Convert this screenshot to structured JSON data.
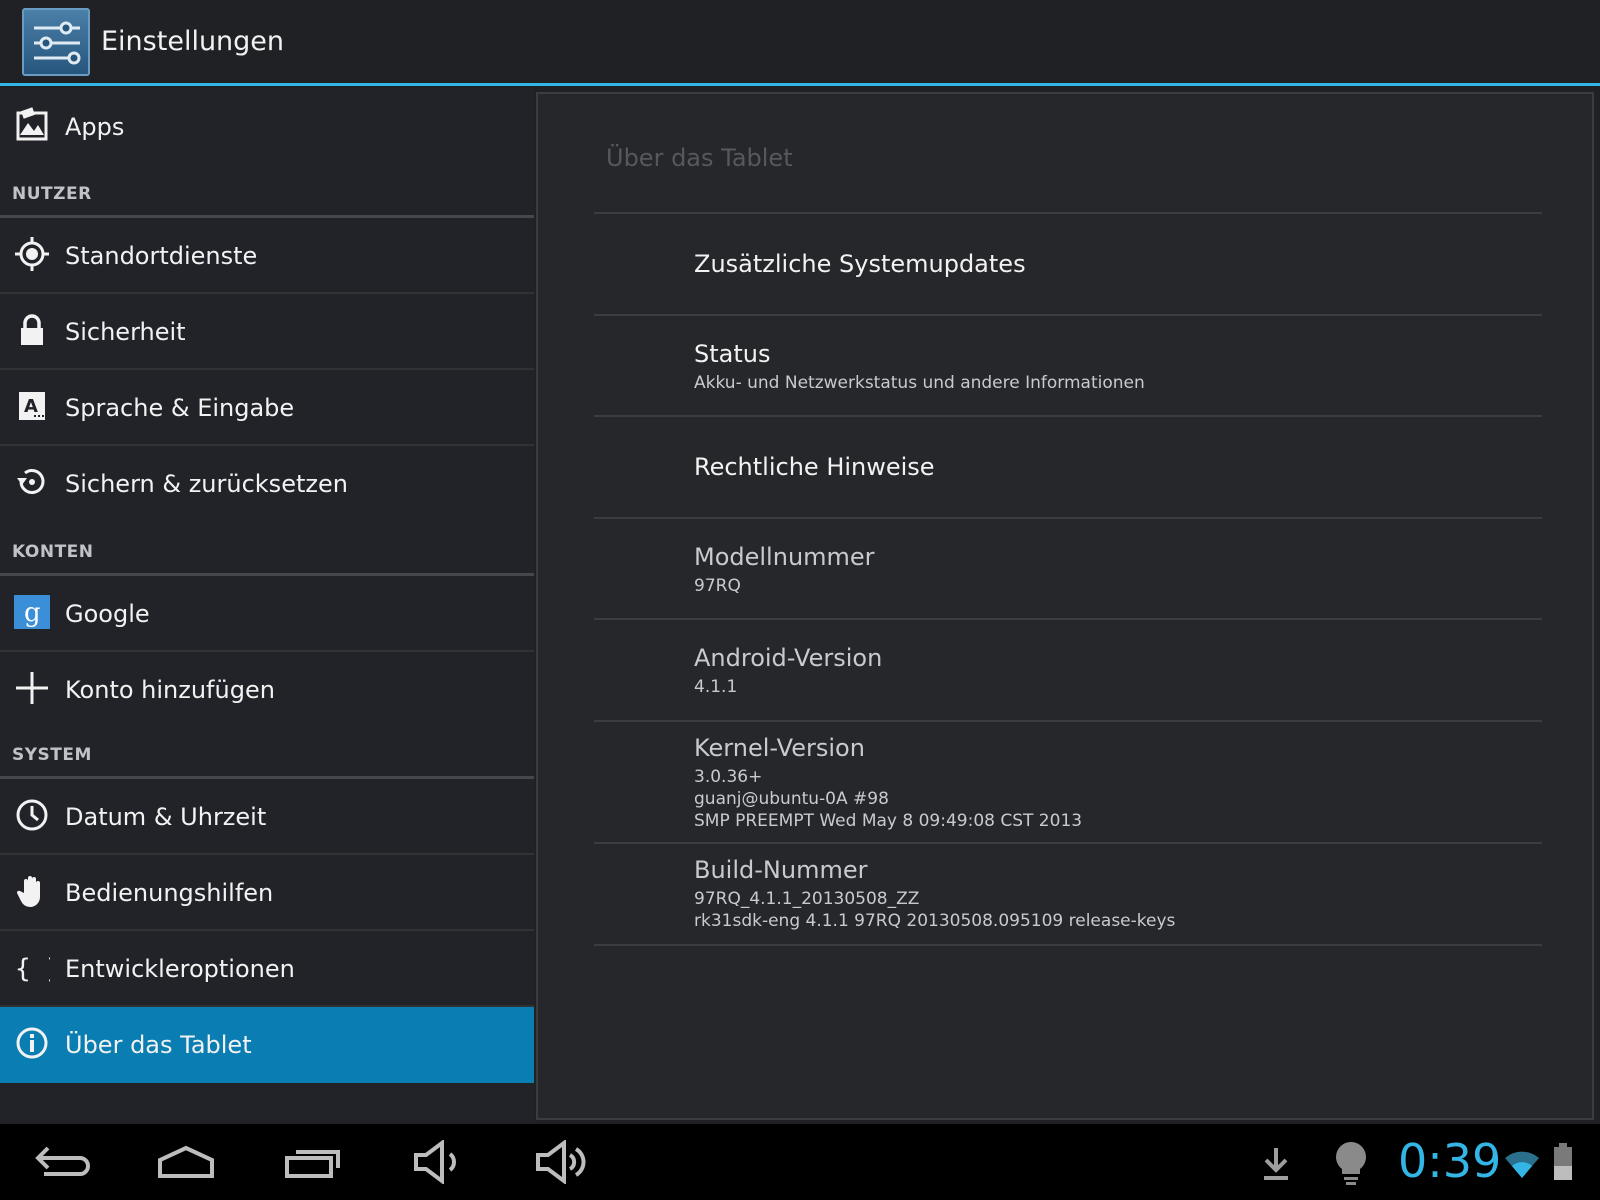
{
  "app": {
    "title": "Einstellungen"
  },
  "sidebar": {
    "apps_label": "Apps",
    "headers": {
      "user": "NUTZER",
      "accounts": "KONTEN",
      "system": "SYSTEM"
    },
    "items": {
      "location": "Standortdienste",
      "security": "Sicherheit",
      "language": "Sprache & Eingabe",
      "backup": "Sichern & zurücksetzen",
      "google": "Google",
      "add_account": "Konto hinzufügen",
      "date_time": "Datum & Uhrzeit",
      "accessibility": "Bedienungshilfen",
      "developer": "Entwickleroptionen",
      "about": "Über das Tablet"
    },
    "selected": "about"
  },
  "about": {
    "title": "Über das Tablet",
    "system_updates": "Zusätzliche Systemupdates",
    "status": {
      "title": "Status",
      "summary": "Akku- und Netzwerkstatus und andere Informationen"
    },
    "legal": "Rechtliche Hinweise",
    "model": {
      "title": "Modellnummer",
      "value": "97RQ"
    },
    "android": {
      "title": "Android-Version",
      "value": "4.1.1"
    },
    "kernel": {
      "title": "Kernel-Version",
      "line1": "3.0.36+",
      "line2": "guanj@ubuntu-0A #98",
      "line3": "SMP PREEMPT Wed May 8 09:49:08 CST 2013"
    },
    "build": {
      "title": "Build-Nummer",
      "line1": "97RQ_4.1.1_20130508_ZZ",
      "line2": "rk31sdk-eng 4.1.1 97RQ 20130508.095109 release-keys"
    }
  },
  "statusbar": {
    "time": "0:39"
  },
  "colors": {
    "accent": "#33b5e5",
    "selected": "#0a7db2",
    "background": "#1f2125"
  }
}
